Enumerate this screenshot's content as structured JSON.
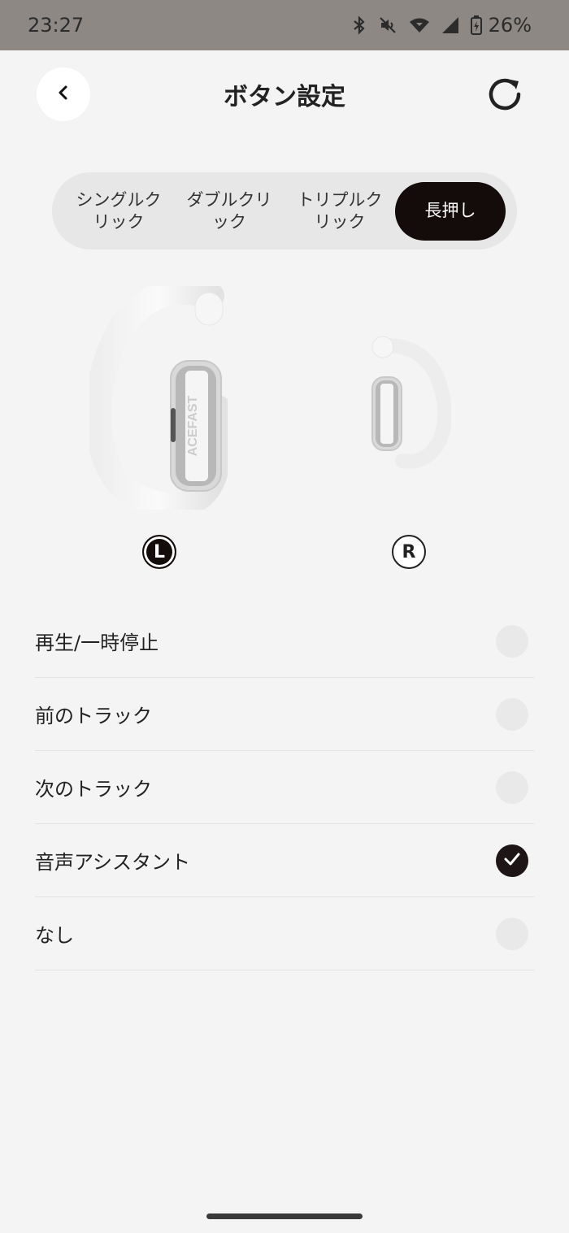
{
  "status_bar": {
    "time": "23:27",
    "battery": "26%",
    "icons": [
      "bluetooth-icon",
      "mute-icon",
      "wifi-icon",
      "signal-icon",
      "battery-icon"
    ]
  },
  "header": {
    "title": "ボタン設定",
    "back_icon": "chevron-left-icon",
    "refresh_icon": "refresh-icon"
  },
  "tabs": [
    {
      "label": "シングルク\nリック",
      "active": false
    },
    {
      "label": "ダブルクリ\nック",
      "active": false
    },
    {
      "label": "トリプルク\nリック",
      "active": false
    },
    {
      "label": "長押し",
      "active": true
    }
  ],
  "earbuds": {
    "left_badge": "L",
    "right_badge": "R",
    "selected": "L",
    "brand_text": "ACEFAST"
  },
  "options": [
    {
      "label": "再生/一時停止",
      "checked": false
    },
    {
      "label": "前のトラック",
      "checked": false
    },
    {
      "label": "次のトラック",
      "checked": false
    },
    {
      "label": "音声アシスタント",
      "checked": true
    },
    {
      "label": "なし",
      "checked": false
    }
  ],
  "colors": {
    "accent": "#140b0b",
    "background": "#f4f4f4",
    "status_bar": "#8d8884"
  }
}
